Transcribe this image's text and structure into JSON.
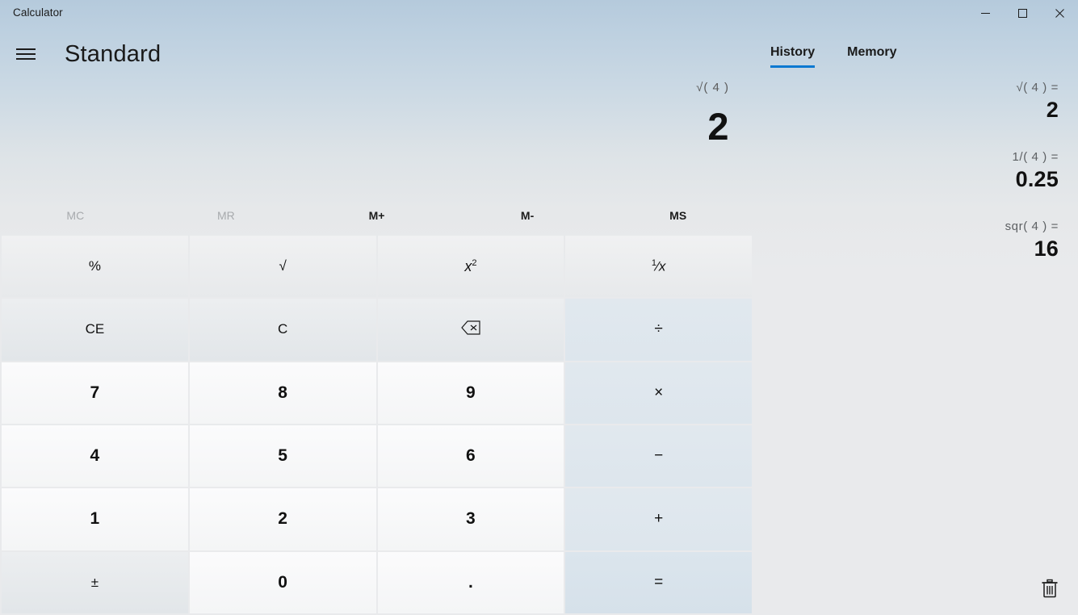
{
  "window": {
    "title": "Calculator",
    "controls": [
      {
        "name": "minimize-button",
        "glyph": "minimize"
      },
      {
        "name": "maximize-button",
        "glyph": "maximize"
      },
      {
        "name": "close-button",
        "glyph": "close"
      }
    ]
  },
  "header": {
    "menu_icon": "hamburger-menu-icon",
    "mode": "Standard"
  },
  "panel": {
    "tabs": [
      {
        "label": "History",
        "active": true
      },
      {
        "label": "Memory",
        "active": false
      }
    ],
    "clear_icon": "trash-icon"
  },
  "display": {
    "expression": "√( 4 )",
    "result": "2"
  },
  "memory": {
    "buttons": [
      {
        "label": "MC",
        "enabled": false
      },
      {
        "label": "MR",
        "enabled": false
      },
      {
        "label": "M+",
        "enabled": true
      },
      {
        "label": "M-",
        "enabled": true
      },
      {
        "label": "MS",
        "enabled": true
      }
    ]
  },
  "keypad": {
    "rows": [
      [
        {
          "label": "%",
          "name": "percent-button",
          "kind": "fn"
        },
        {
          "label": "√",
          "name": "square-root-button",
          "kind": "fn"
        },
        {
          "label": "x²",
          "name": "square-button",
          "kind": "fn"
        },
        {
          "label": "¹/x",
          "name": "reciprocal-button",
          "kind": "fn"
        }
      ],
      [
        {
          "label": "CE",
          "name": "clear-entry-button",
          "kind": "fn2"
        },
        {
          "label": "C",
          "name": "clear-button",
          "kind": "fn2"
        },
        {
          "label": "backspace",
          "name": "backspace-button",
          "kind": "fn2"
        },
        {
          "label": "÷",
          "name": "divide-button",
          "kind": "op"
        }
      ],
      [
        {
          "label": "7",
          "name": "digit-7-button",
          "kind": "num"
        },
        {
          "label": "8",
          "name": "digit-8-button",
          "kind": "num"
        },
        {
          "label": "9",
          "name": "digit-9-button",
          "kind": "num"
        },
        {
          "label": "×",
          "name": "multiply-button",
          "kind": "op"
        }
      ],
      [
        {
          "label": "4",
          "name": "digit-4-button",
          "kind": "num"
        },
        {
          "label": "5",
          "name": "digit-5-button",
          "kind": "num"
        },
        {
          "label": "6",
          "name": "digit-6-button",
          "kind": "num"
        },
        {
          "label": "−",
          "name": "subtract-button",
          "kind": "op"
        }
      ],
      [
        {
          "label": "1",
          "name": "digit-1-button",
          "kind": "num"
        },
        {
          "label": "2",
          "name": "digit-2-button",
          "kind": "num"
        },
        {
          "label": "3",
          "name": "digit-3-button",
          "kind": "num"
        },
        {
          "label": "+",
          "name": "add-button",
          "kind": "op"
        }
      ],
      [
        {
          "label": "±",
          "name": "sign-toggle-button",
          "kind": "fn2"
        },
        {
          "label": "0",
          "name": "digit-0-button",
          "kind": "num"
        },
        {
          "label": ".",
          "name": "decimal-point-button",
          "kind": "num"
        },
        {
          "label": "=",
          "name": "equals-button",
          "kind": "op equals"
        }
      ]
    ]
  },
  "history": {
    "items": [
      {
        "expression": "√( 4 ) =",
        "result": "2"
      },
      {
        "expression": "1/( 4 ) =",
        "result": "0.25"
      },
      {
        "expression": "sqr( 4 ) =",
        "result": "16"
      }
    ]
  },
  "colors": {
    "accent": "#0a79d1",
    "titlebar_top": "#b5cadc",
    "body": "#e9eaec"
  }
}
